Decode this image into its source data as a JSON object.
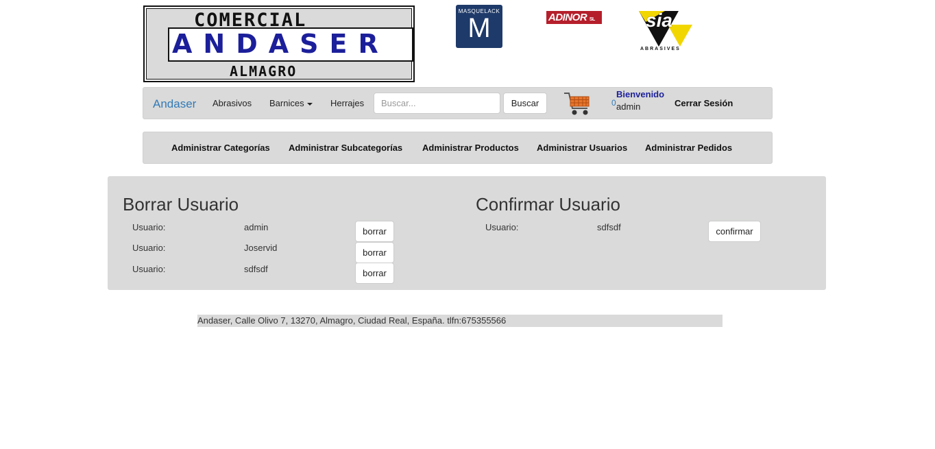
{
  "header": {
    "logo_main": {
      "top": "COMERCIAL",
      "middle": "ANDASER",
      "bottom": "ALMAGRO"
    },
    "logo_masquelack": {
      "small": "MASQUELACK",
      "big": "M"
    },
    "logo_adinor": {
      "name": "ADINOR",
      "suffix": "SL"
    },
    "logo_sia": {
      "name": "sia",
      "sub": "ABRASIVES"
    }
  },
  "navbar": {
    "brand": "Andaser",
    "links": [
      "Abrasivos",
      "Barnices",
      "Herrajes"
    ],
    "search_placeholder": "Buscar...",
    "search_button": "Buscar",
    "cart_count": "0",
    "welcome": "Bienvenido",
    "username": "admin",
    "logout": "Cerrar Sesión",
    "icons": {
      "cart": "shopping-cart-icon",
      "dropdown": "caret-down-icon"
    }
  },
  "admin_menu": {
    "items": [
      "Administrar Categorías",
      "Administrar Subcategorías",
      "Administrar Productos",
      "Administrar Usuarios",
      "Administrar Pedidos"
    ]
  },
  "delete_section": {
    "title": "Borrar Usuario",
    "rows": [
      {
        "label": "Usuario:",
        "value": "admin",
        "button": "borrar"
      },
      {
        "label": "Usuario:",
        "value": "Joservid",
        "button": "borrar"
      },
      {
        "label": "Usuario:",
        "value": "sdfsdf",
        "button": "borrar"
      }
    ]
  },
  "confirm_section": {
    "title": "Confirmar Usuario",
    "rows": [
      {
        "label": "Usuario:",
        "value": "sdfsdf",
        "button": "confirmar"
      }
    ]
  },
  "footer": {
    "text": "Andaser, Calle Olivo 7, 13270, Almagro, Ciudad Real, España. tlfn:675355566"
  },
  "colors": {
    "panel_bg": "#d9dad9",
    "brand_blue": "#337ab7",
    "logo_blue": "#1c1f9a",
    "adinor_red": "#b51f2b",
    "masquelack_navy": "#1e3a6a",
    "sia_yellow": "#f2d600"
  }
}
